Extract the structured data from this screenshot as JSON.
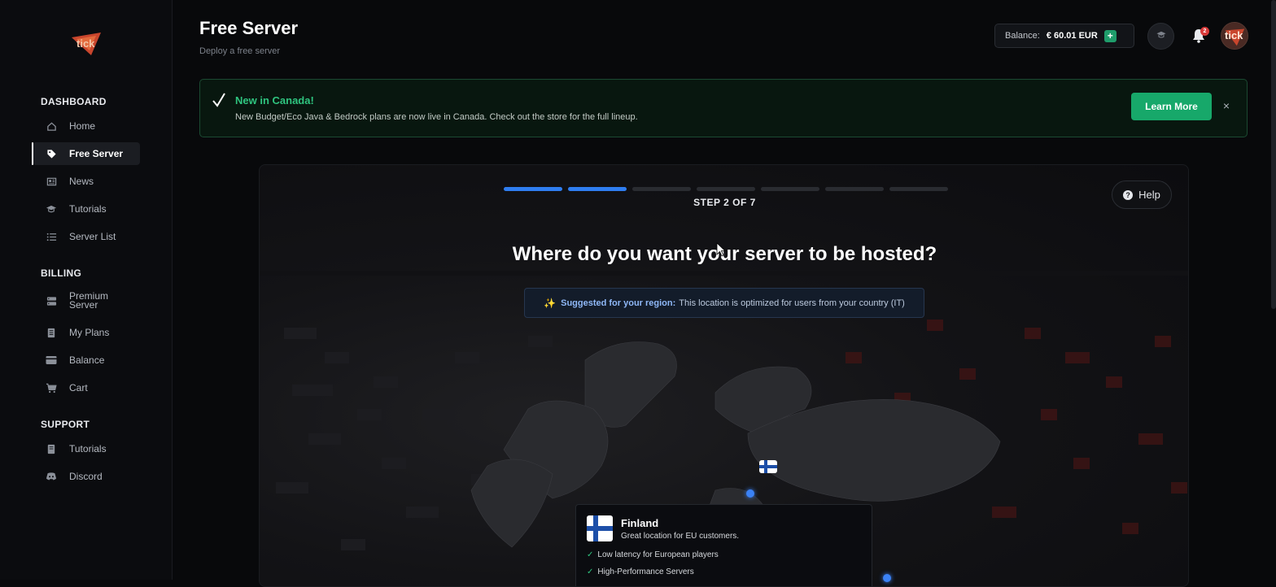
{
  "sidebar": {
    "logo_text": "tick",
    "sections": [
      {
        "title": "DASHBOARD",
        "items": [
          {
            "label": "Home",
            "icon": "home-icon"
          },
          {
            "label": "Free Server",
            "icon": "tag-icon",
            "active": true
          },
          {
            "label": "News",
            "icon": "newspaper-icon"
          },
          {
            "label": "Tutorials",
            "icon": "graduation-cap-icon"
          },
          {
            "label": "Server List",
            "icon": "list-icon"
          }
        ]
      },
      {
        "title": "BILLING",
        "items": [
          {
            "label": "Premium Server",
            "icon": "server-icon"
          },
          {
            "label": "My Plans",
            "icon": "document-icon"
          },
          {
            "label": "Balance",
            "icon": "wallet-icon"
          },
          {
            "label": "Cart",
            "icon": "cart-icon"
          }
        ]
      },
      {
        "title": "SUPPORT",
        "items": [
          {
            "label": "Tutorials",
            "icon": "book-icon"
          },
          {
            "label": "Discord",
            "icon": "discord-icon"
          }
        ]
      }
    ]
  },
  "header": {
    "title": "Free Server",
    "subtitle": "Deploy a free server",
    "balance_label": "Balance:",
    "balance_value": "€ 60.01 EUR",
    "balance_add": "+",
    "notifications_count": "2",
    "avatar_text": "tick"
  },
  "banner": {
    "title": "New in Canada!",
    "text": "New Budget/Eco Java & Bedrock plans are now live in Canada. Check out the store for the full lineup.",
    "button_label": "Learn More",
    "close_symbol": "×"
  },
  "wizard": {
    "total_steps": 7,
    "current_step": 2,
    "step_label": "STEP 2 OF 7",
    "help_label": "Help",
    "question": "Where do you want your server to be hosted?",
    "suggest_icon": "✨",
    "suggest_strong": "Suggested for your region:",
    "suggest_text": "This location is optimized for users from your country (IT)"
  },
  "location_card": {
    "country": "Finland",
    "description": "Great location for EU customers.",
    "features": [
      "Low latency for European players",
      "High-Performance Servers"
    ]
  },
  "colors": {
    "accent_blue": "#2f7df0",
    "accent_green": "#17a86a",
    "success_text": "#2fc47f",
    "badge_red": "#d83a3a"
  }
}
